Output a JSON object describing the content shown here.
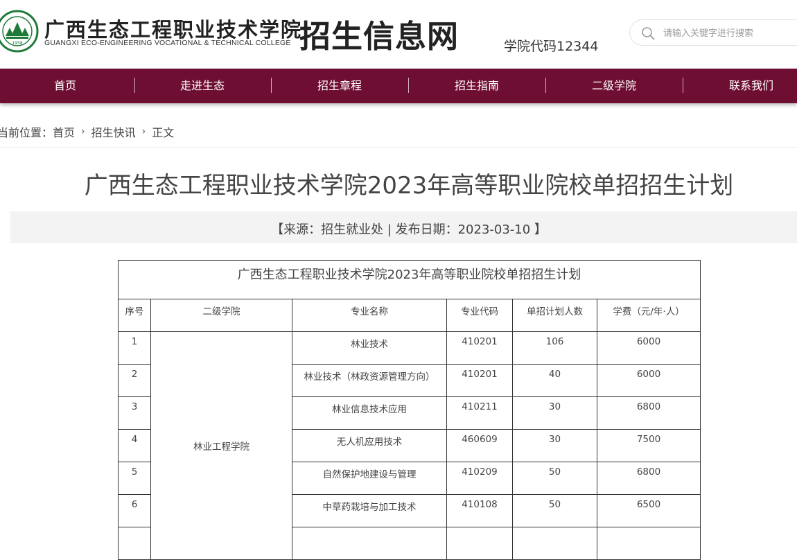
{
  "header": {
    "school_name_cn": "广西生态工程职业技术学院",
    "school_name_en": "GUANGXI ECO-ENGINEERING VOCATIONAL & TECHNICAL COLLEGE",
    "seal_year": "1958",
    "site_name": "招生信息网",
    "college_code": "学院代码12344",
    "search": {
      "placeholder": "请输入关键字进行搜索",
      "icon": "search-icon"
    }
  },
  "colors": {
    "nav_bg": "#6f0e33",
    "accent_green": "#1f7a3a"
  },
  "nav": {
    "items": [
      {
        "label": "首页"
      },
      {
        "label": "走进生态"
      },
      {
        "label": "招生章程"
      },
      {
        "label": "招生指南"
      },
      {
        "label": "二级学院"
      },
      {
        "label": "联系我们"
      }
    ]
  },
  "breadcrumb": {
    "prefix": "当前位置：",
    "items": [
      "首页",
      "招生快讯",
      "正文"
    ]
  },
  "article": {
    "title": "广西生态工程职业技术学院2023年高等职业院校单招招生计划",
    "meta": "【来源：招生就业处 | 发布日期：2023-03-10 】"
  },
  "table": {
    "caption": "广西生态工程职业技术学院2023年高等职业院校单招招生计划",
    "headers": [
      "序号",
      "二级学院",
      "专业名称",
      "专业代码",
      "单招计划人数",
      "学费（元/年·人）"
    ],
    "department": "林业工程学院",
    "rows": [
      {
        "no": "1",
        "major": "林业技术",
        "code": "410201",
        "plan": "106",
        "fee": "6000"
      },
      {
        "no": "2",
        "major": "林业技术（林政资源管理方向）",
        "code": "410201",
        "plan": "40",
        "fee": "6000"
      },
      {
        "no": "3",
        "major": "林业信息技术应用",
        "code": "410211",
        "plan": "30",
        "fee": "6800"
      },
      {
        "no": "4",
        "major": "无人机应用技术",
        "code": "460609",
        "plan": "30",
        "fee": "7500"
      },
      {
        "no": "5",
        "major": "自然保护地建设与管理",
        "code": "410209",
        "plan": "50",
        "fee": "6800"
      },
      {
        "no": "6",
        "major": "中草药栽培与加工技术",
        "code": "410108",
        "plan": "50",
        "fee": "6500"
      }
    ]
  }
}
